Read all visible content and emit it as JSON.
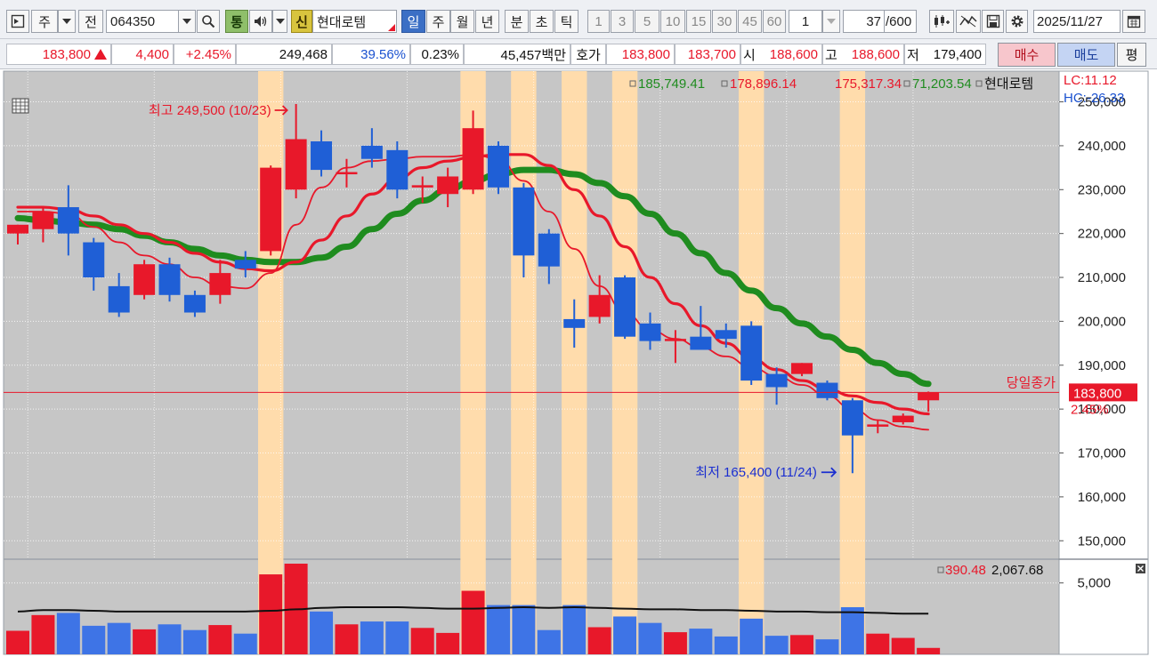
{
  "toolbar": {
    "period_unit": "주",
    "prefix": "전",
    "code": "064350",
    "tong": "통",
    "sin": "신",
    "stock_name": "현대로템",
    "period_tabs": [
      {
        "label": "일",
        "selected": true
      },
      {
        "label": "주",
        "selected": false
      },
      {
        "label": "월",
        "selected": false
      },
      {
        "label": "년",
        "selected": false
      },
      {
        "label": "분",
        "selected": false
      },
      {
        "label": "초",
        "selected": false
      },
      {
        "label": "틱",
        "selected": false
      }
    ],
    "intervals": [
      "1",
      "3",
      "5",
      "10",
      "15",
      "30",
      "45",
      "60"
    ],
    "interval_input": "1",
    "count": "37",
    "count_max": "/600",
    "date": "2025/11/27"
  },
  "quote": {
    "price": "183,800",
    "change": "4,400",
    "change_pct": "+2.45%",
    "volume": "249,468",
    "volume_ratio": "39.56%",
    "turnover": "0.23%",
    "amount": "45,457백만",
    "hoga_label": "호가",
    "ask": "183,800",
    "bid": "183,700",
    "open_label": "시",
    "open": "188,600",
    "high_label": "고",
    "high": "188,600",
    "low_label": "저",
    "low": "179,400",
    "buy_label": "매수",
    "sell_label": "매도",
    "eval_label": "평"
  },
  "colors": {
    "up": "#e8182a",
    "down": "#1f5fd6",
    "ma_green": "#1f8c1f",
    "ma_red": "#e8182a",
    "highlight": "#ffdcac",
    "plot_bg": "#c6c6c6"
  },
  "chart_data": {
    "type": "candlestick",
    "legend": {
      "ma1": "185,749.41",
      "ma2": "178,896.14",
      "ma3": "175,317.34",
      "ma4": "71,203.54",
      "name": "현대로템"
    },
    "lc_label": "LC:11.12",
    "hc_label": "HC:-26.33",
    "y_ticks": [
      "250,000",
      "240,000",
      "230,000",
      "220,000",
      "210,000",
      "200,000",
      "190,000",
      "180,000",
      "170,000",
      "160,000",
      "150,000"
    ],
    "y_tick_values": [
      250000,
      240000,
      230000,
      220000,
      210000,
      200000,
      190000,
      180000,
      170000,
      160000,
      150000
    ],
    "ylim": [
      146000,
      257000
    ],
    "last_close_label": "183,800",
    "last_close_value": 183800,
    "last_change_label": "2.45%",
    "today_close_label": "당일종가",
    "max_annotation": "최고 249,500 (10/23)",
    "min_annotation": "최저 165,400 (11/24)",
    "max_index": 11,
    "min_index": 33,
    "highlight_indices": [
      10,
      18,
      20,
      22,
      24,
      29,
      33
    ],
    "candles": [
      {
        "o": 220000,
        "h": 222000,
        "l": 217500,
        "c": 222000
      },
      {
        "o": 221000,
        "h": 226000,
        "l": 218000,
        "c": 225000
      },
      {
        "o": 226000,
        "h": 231000,
        "l": 215000,
        "c": 220000
      },
      {
        "o": 218000,
        "h": 219000,
        "l": 207000,
        "c": 210000
      },
      {
        "o": 208000,
        "h": 211000,
        "l": 201000,
        "c": 202000
      },
      {
        "o": 206000,
        "h": 214000,
        "l": 205000,
        "c": 213000
      },
      {
        "o": 213000,
        "h": 214500,
        "l": 204500,
        "c": 206000
      },
      {
        "o": 206000,
        "h": 207000,
        "l": 201000,
        "c": 202000
      },
      {
        "o": 206000,
        "h": 214000,
        "l": 204000,
        "c": 211000
      },
      {
        "o": 214000,
        "h": 216000,
        "l": 210000,
        "c": 212000
      },
      {
        "o": 216000,
        "h": 235500,
        "l": 215000,
        "c": 235000
      },
      {
        "o": 230000,
        "h": 249500,
        "l": 228000,
        "c": 241500
      },
      {
        "o": 241000,
        "h": 243500,
        "l": 233000,
        "c": 234500
      },
      {
        "o": 234000,
        "h": 237000,
        "l": 230500,
        "c": 234000
      },
      {
        "o": 240000,
        "h": 244000,
        "l": 235000,
        "c": 237000
      },
      {
        "o": 239000,
        "h": 241000,
        "l": 228000,
        "c": 230000
      },
      {
        "o": 231000,
        "h": 233000,
        "l": 227000,
        "c": 231000
      },
      {
        "o": 229000,
        "h": 235000,
        "l": 226000,
        "c": 233000
      },
      {
        "o": 230000,
        "h": 248000,
        "l": 229000,
        "c": 244000
      },
      {
        "o": 240000,
        "h": 241000,
        "l": 229000,
        "c": 230500
      },
      {
        "o": 230500,
        "h": 231500,
        "l": 210000,
        "c": 215000
      },
      {
        "o": 220000,
        "h": 221000,
        "l": 208500,
        "c": 212500
      },
      {
        "o": 200500,
        "h": 205000,
        "l": 194000,
        "c": 198500
      },
      {
        "o": 201000,
        "h": 210500,
        "l": 199500,
        "c": 206000
      },
      {
        "o": 210000,
        "h": 210500,
        "l": 196000,
        "c": 196500
      },
      {
        "o": 199500,
        "h": 202000,
        "l": 193500,
        "c": 195500
      },
      {
        "o": 196000,
        "h": 198000,
        "l": 190500,
        "c": 196000
      },
      {
        "o": 196500,
        "h": 203500,
        "l": 193500,
        "c": 193500
      },
      {
        "o": 198000,
        "h": 199500,
        "l": 194000,
        "c": 196000
      },
      {
        "o": 199000,
        "h": 200000,
        "l": 185500,
        "c": 186500
      },
      {
        "o": 188000,
        "h": 189500,
        "l": 181000,
        "c": 185000
      },
      {
        "o": 188000,
        "h": 190500,
        "l": 187500,
        "c": 190500
      },
      {
        "o": 186000,
        "h": 186500,
        "l": 182000,
        "c": 182500
      },
      {
        "o": 182000,
        "h": 182500,
        "l": 165400,
        "c": 174000
      },
      {
        "o": 176000,
        "h": 177500,
        "l": 174500,
        "c": 176500
      },
      {
        "o": 177000,
        "h": 179000,
        "l": 176500,
        "c": 178500
      },
      {
        "o": 182000,
        "h": 184000,
        "l": 179400,
        "c": 183800
      }
    ],
    "ma_short": [
      225000,
      225000,
      224500,
      221500,
      218000,
      215000,
      213000,
      210000,
      208000,
      207500,
      211000,
      222000,
      230500,
      235000,
      236500,
      237000,
      237500,
      237500,
      238000,
      237000,
      232000,
      225000,
      216500,
      208000,
      202000,
      198000,
      196000,
      194000,
      192000,
      189500,
      187500,
      185500,
      183000,
      180000,
      177500,
      176000,
      175300
    ],
    "ma_mid": [
      226000,
      226000,
      225500,
      224000,
      222000,
      220000,
      218000,
      215500,
      213500,
      212000,
      211500,
      213500,
      218500,
      224000,
      229000,
      232500,
      235000,
      236500,
      237500,
      238000,
      238000,
      235500,
      230000,
      224000,
      217000,
      210000,
      204000,
      199000,
      195000,
      191500,
      189000,
      186500,
      184500,
      183000,
      181500,
      180000,
      178900
    ],
    "ma_long": [
      223500,
      223000,
      222500,
      222000,
      221000,
      219500,
      218000,
      216500,
      215000,
      214000,
      213500,
      213500,
      214500,
      217000,
      221000,
      224500,
      227500,
      230000,
      232000,
      233500,
      234500,
      234500,
      233500,
      231500,
      228500,
      224500,
      220000,
      215500,
      211000,
      207000,
      203000,
      199500,
      196500,
      193500,
      190500,
      188000,
      185750
    ],
    "volume_legend_a": "390.48",
    "volume_legend_b": "2,067.68",
    "volume_tick": "5,000",
    "volume_tick_value": 5000,
    "volume_max": 6600,
    "volumes": [
      1650,
      2750,
      2900,
      2000,
      2200,
      1750,
      2100,
      1700,
      2050,
      1450,
      5600,
      6350,
      3000,
      2100,
      2300,
      2300,
      1850,
      1500,
      4450,
      3450,
      3450,
      1700,
      3450,
      1900,
      2650,
      2200,
      1550,
      1800,
      1250,
      2500,
      1300,
      1350,
      1050,
      3300,
      1450,
      1150,
      450
    ],
    "volume_ma": [
      3000,
      3100,
      3100,
      3050,
      3000,
      3000,
      3000,
      3000,
      3000,
      3000,
      3050,
      3150,
      3250,
      3300,
      3300,
      3300,
      3250,
      3200,
      3200,
      3250,
      3300,
      3250,
      3300,
      3250,
      3200,
      3150,
      3150,
      3100,
      3100,
      3050,
      3000,
      3000,
      2950,
      2950,
      2900,
      2850,
      2850
    ]
  }
}
